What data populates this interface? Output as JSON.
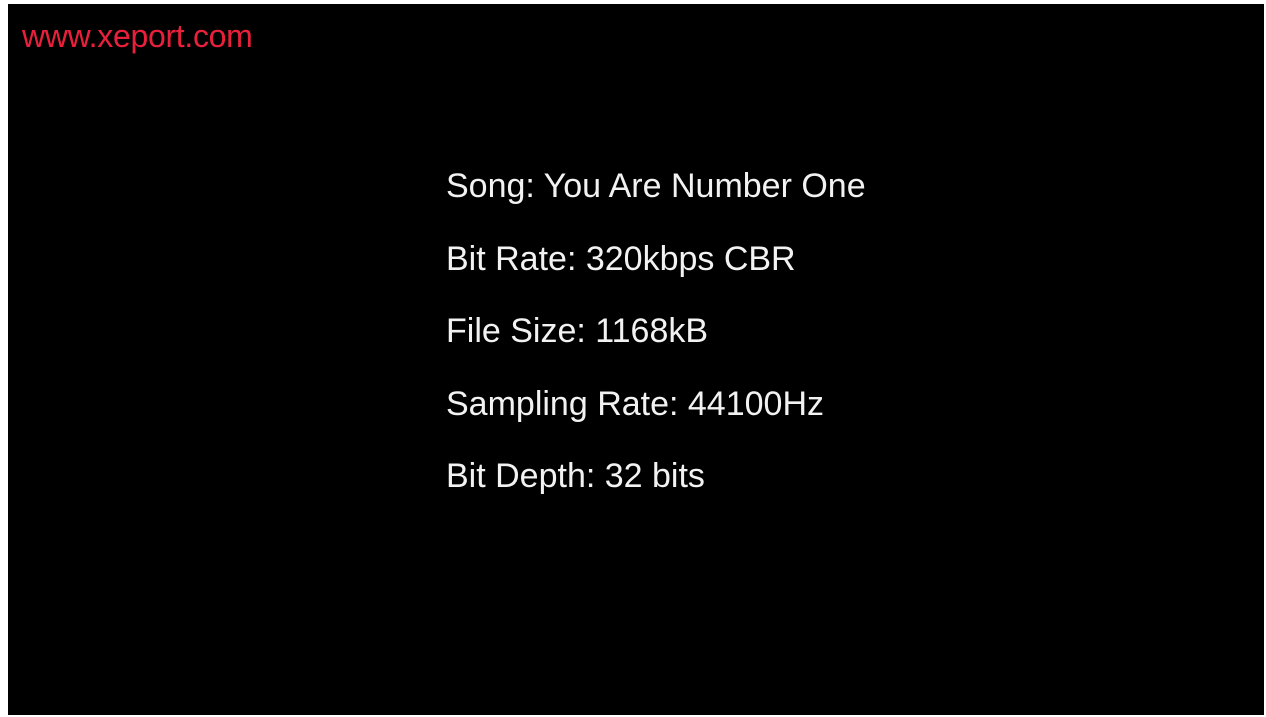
{
  "watermark": {
    "text": "www.xeport.com",
    "color": "#e8203c"
  },
  "background_color": "#000000",
  "text_color": "#f2f2f2",
  "info": {
    "lines": [
      "Song: You Are Number One",
      "Bit Rate: 320kbps CBR",
      "File Size: 1168kB",
      "Sampling Rate: 44100Hz",
      "Bit Depth: 32 bits"
    ]
  }
}
